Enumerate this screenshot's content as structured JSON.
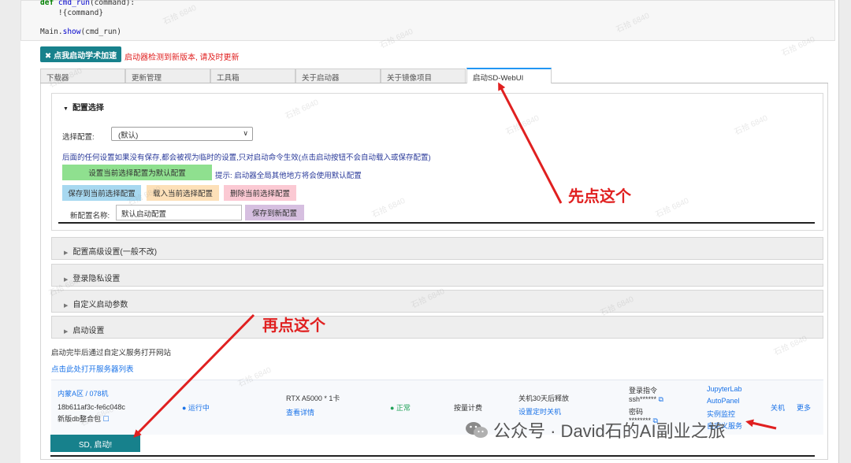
{
  "code": {
    "line1_keyword": "def",
    "line1_name": "cmd_run",
    "line1_rest": "(command):",
    "line2": "    !{command}",
    "line3_obj": "Main.",
    "line3_fn": "show",
    "line3_rest": "(cmd_run)"
  },
  "top": {
    "accel_button": "✖ 点我启动学术加速",
    "update_note": "启动器检测到新版本, 请及时更新"
  },
  "tabs": [
    {
      "label": "下载器"
    },
    {
      "label": "更新管理"
    },
    {
      "label": "工具箱"
    },
    {
      "label": "关于启动器"
    },
    {
      "label": "关于镜像项目"
    },
    {
      "label": "启动SD-WebUI"
    }
  ],
  "config": {
    "title": "配置选择",
    "select_label": "选择配置:",
    "select_value": "(默认)",
    "note": "后面的任何设置如果没有保存,都会被视为临时的设置,只对启动命令生效(点击启动按钮不会自动载入或保存配置)",
    "set_default_btn": "设置当前选择配置为默认配置",
    "hint": "提示: 启动器全局其他地方将会使用默认配置",
    "save_btn": "保存到当前选择配置",
    "load_btn": "载入当前选择配置",
    "delete_btn": "删除当前选择配置",
    "new_name_label": "新配置名称:",
    "new_name_value": "默认启动配置",
    "save_new_btn": "保存到新配置"
  },
  "accordions": [
    {
      "label": "配置高级设置(一般不改)"
    },
    {
      "label": "登录隐私设置"
    },
    {
      "label": "自定义启动参数"
    },
    {
      "label": "启动设置"
    }
  ],
  "launch": {
    "open_site_text": "启动完毕后通过自定义服务打开网站",
    "server_list_link": "点击此处打开服务器列表",
    "sd_button": "SD, 启动!"
  },
  "server": {
    "region": "内蒙A区 / 078机",
    "id": "18b611af3c-fe6c048c",
    "image": "新版db整合包",
    "status": "● 运行中",
    "gpu": "RTX A5000 * 1卡",
    "details": "查看详情",
    "health": "● 正常",
    "billing": "按量计费",
    "release": "关机30天后释放",
    "timer": "设置定时关机",
    "login_cmd": "登录指令",
    "ssh": "ssh******",
    "pwd_label": "密码",
    "pwd": "********",
    "jupyter": "JupyterLab",
    "autopanel": "AutoPanel",
    "monitor": "实例监控",
    "custom_service": "自定义服务",
    "shutdown": "关机",
    "more": "更多"
  },
  "annotations": {
    "first": "先点这个",
    "second": "再点这个"
  },
  "watermark": {
    "footer": "公众号 · David石的AI副业之旅",
    "tile": "石拾 6840"
  },
  "colors": {
    "teal": "#17818c",
    "red": "#e02020",
    "blue_link": "#1a73e8",
    "green_btn": "#8fe08f",
    "light_blue_btn": "#a7d8f0",
    "orange_btn": "#fde0b8",
    "pink_btn": "#fbc9d3",
    "purple_btn": "#d6bfe0"
  }
}
